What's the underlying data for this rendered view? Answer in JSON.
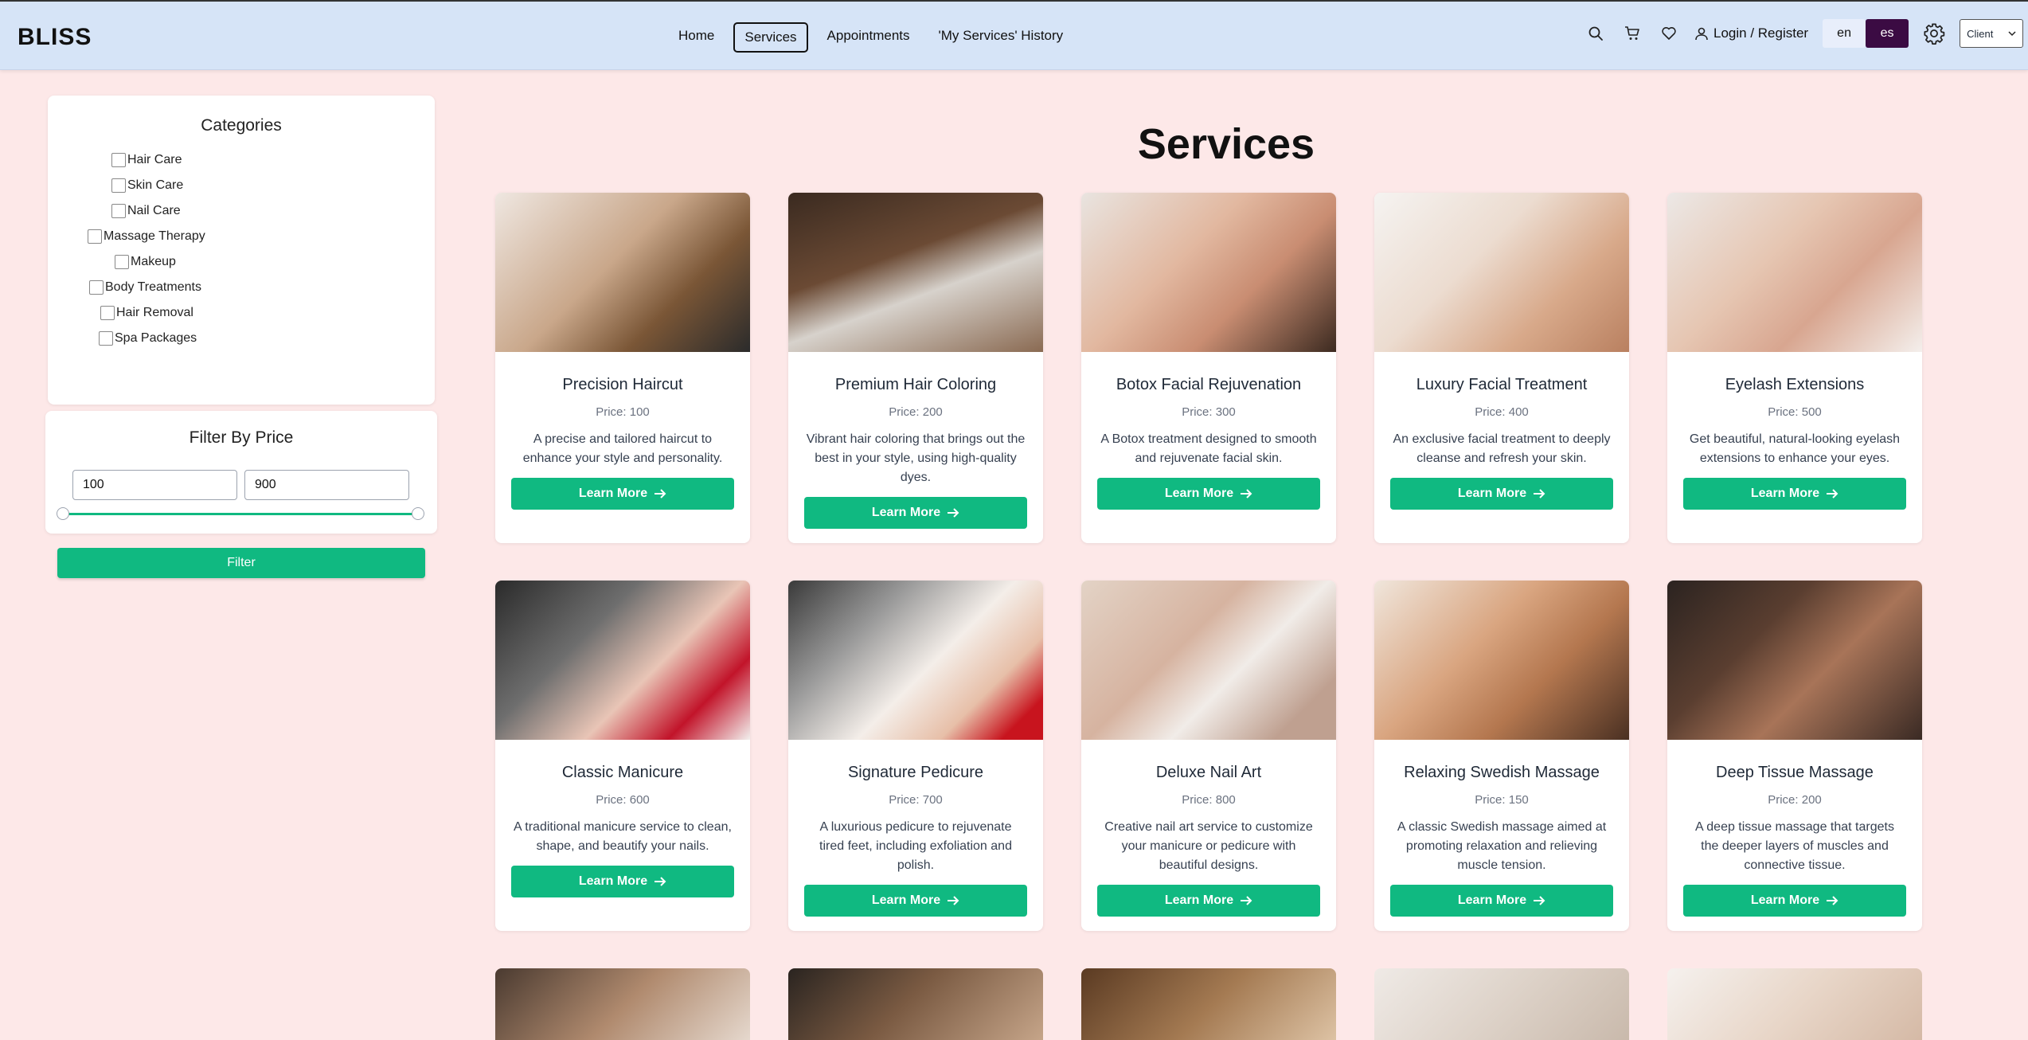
{
  "navbar": {
    "brand": "BLISS",
    "links": [
      "Home",
      "Services",
      "Appointments",
      "'My Services' History"
    ],
    "login_label": "Login / Register",
    "lang_en": "en",
    "lang_es": "es",
    "role": "Client",
    "icons": [
      "search-icon",
      "cart-icon",
      "heart-icon",
      "user-icon",
      "gear-icon"
    ]
  },
  "sidebar": {
    "categories_title": "Categories",
    "categories": [
      "Hair Care",
      "Skin Care",
      "Nail Care",
      "Massage Therapy",
      "Makeup",
      "Body Treatments",
      "Hair Removal",
      "Spa Packages"
    ],
    "price_title": "Filter By Price",
    "price_min": "100",
    "price_max": "900",
    "filter_label": "Filter"
  },
  "main": {
    "title": "Services",
    "learn_more": "Learn More",
    "services": [
      {
        "title": "Precision Haircut",
        "price": "Price: 100",
        "desc": "A precise and tailored haircut to enhance your style and personality."
      },
      {
        "title": "Premium Hair Coloring",
        "price": "Price: 200",
        "desc": "Vibrant hair coloring that brings out the best in your style, using high-quality dyes."
      },
      {
        "title": "Botox Facial Rejuvenation",
        "price": "Price: 300",
        "desc": "A Botox treatment designed to smooth and rejuvenate facial skin."
      },
      {
        "title": "Luxury Facial Treatment",
        "price": "Price: 400",
        "desc": "An exclusive facial treatment to deeply cleanse and refresh your skin."
      },
      {
        "title": "Eyelash Extensions",
        "price": "Price: 500",
        "desc": "Get beautiful, natural-looking eyelash extensions to enhance your eyes."
      },
      {
        "title": "Classic Manicure",
        "price": "Price: 600",
        "desc": "A traditional manicure service to clean, shape, and beautify your nails."
      },
      {
        "title": "Signature Pedicure",
        "price": "Price: 700",
        "desc": "A luxurious pedicure to rejuvenate tired feet, including exfoliation and polish."
      },
      {
        "title": "Deluxe Nail Art",
        "price": "Price: 800",
        "desc": "Creative nail art service to customize your manicure or pedicure with beautiful designs."
      },
      {
        "title": "Relaxing Swedish Massage",
        "price": "Price: 150",
        "desc": "A classic Swedish massage aimed at promoting relaxation and relieving muscle tension."
      },
      {
        "title": "Deep Tissue Massage",
        "price": "Price: 200",
        "desc": "A deep tissue massage that targets the deeper layers of muscles and connective tissue."
      }
    ]
  },
  "colors": {
    "accent": "#10b981",
    "navbar_bg": "#d6e4f7",
    "page_bg": "#fde8e8",
    "lang_active": "#3b0b43"
  }
}
